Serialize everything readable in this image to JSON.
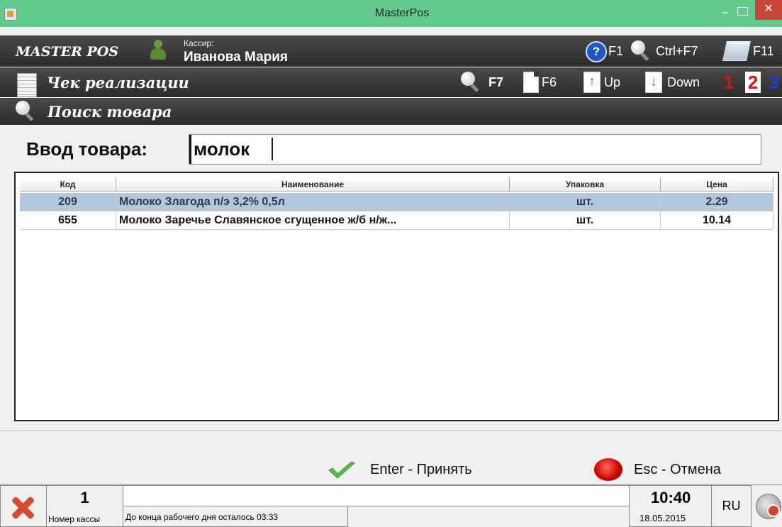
{
  "window": {
    "title": "MasterPos",
    "minimize": "–",
    "close": "✕"
  },
  "header": {
    "brand": "MASTER POS",
    "cashier_caption": "Кассир:",
    "cashier_name": "Иванова Мария",
    "hotkeys": [
      {
        "icon": "help-icon",
        "label": "F1"
      },
      {
        "icon": "search-icon",
        "label": "Ctrl+F7"
      },
      {
        "icon": "calculator-icon",
        "label": "F11"
      }
    ]
  },
  "receipt_bar": {
    "title": "Чек реализации",
    "hotkeys": [
      {
        "icon": "search-icon",
        "label": "F7"
      },
      {
        "icon": "document-icon",
        "label": "F6"
      },
      {
        "icon": "arrow-up-icon",
        "label": "Up"
      },
      {
        "icon": "arrow-down-icon",
        "label": "Down"
      }
    ],
    "tabs": [
      {
        "label": "1",
        "color": "#e01010",
        "bg": "transparent"
      },
      {
        "label": "2",
        "color": "#e01010",
        "bg": "#ffffff"
      },
      {
        "label": "3",
        "color": "#1b3fd6",
        "bg": "transparent"
      }
    ]
  },
  "search_bar": {
    "title": "Поиск товара"
  },
  "product_input": {
    "label": "Ввод товара:",
    "value": "молок"
  },
  "table": {
    "columns": [
      "Код",
      "Наименование",
      "Упаковка",
      "Цена"
    ],
    "rows": [
      {
        "code": "209",
        "name": "Молоко Злагода п/э 3,2% 0,5л",
        "pack": "шт.",
        "price": "2.29",
        "selected": true
      },
      {
        "code": "655",
        "name": "Молоко Заречье Славянское сгущенное ж/б н/ж...",
        "pack": "шт.",
        "price": "10.14",
        "selected": false
      }
    ]
  },
  "actions": {
    "accept": "Enter - Принять",
    "cancel": "Esc - Отмена"
  },
  "status": {
    "register_number": "1",
    "register_caption": "Номер кассы",
    "message": "",
    "workday_left": "До конца рабочего дня осталось 03:33",
    "time": "10:40",
    "date": "18.05.2015",
    "language": "RU"
  },
  "colors": {
    "title_bar": "#63ca8e",
    "dark_bar": "#3a3a3a",
    "selected_row": "#b2c7dd",
    "close_button": "#c7463a"
  }
}
